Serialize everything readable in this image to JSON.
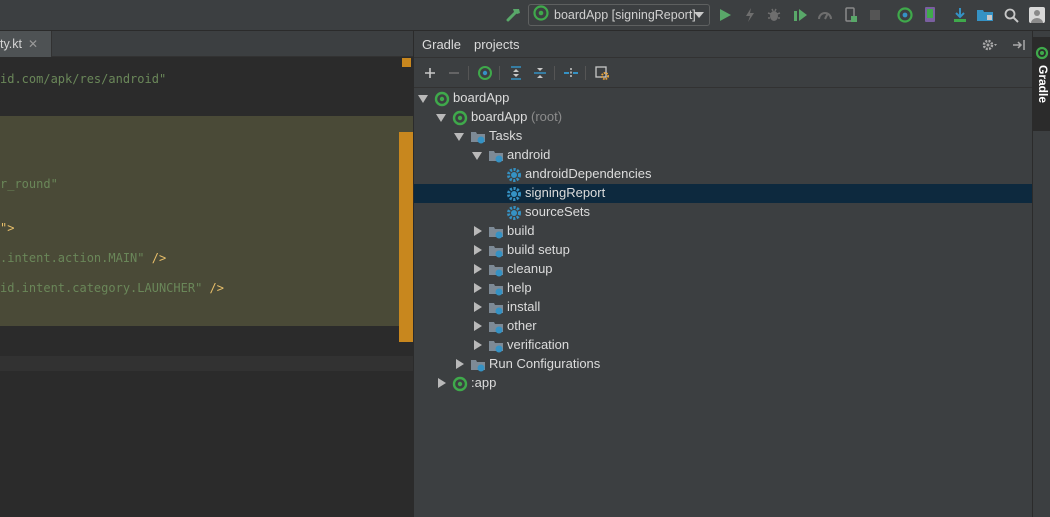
{
  "toolbar": {
    "run_config_label": "boardApp [signingReport]",
    "icons": [
      "build-hammer-icon",
      "run-config-gradle-icon",
      "run-icon",
      "apply-changes-icon",
      "debug-icon",
      "run-with-coverage-icon",
      "profile-icon",
      "attach-debugger-icon",
      "stop-icon",
      "sync-gradle-icon",
      "avd-manager-icon",
      "sdk-manager-icon",
      "project-structure-icon",
      "search-icon",
      "user-icon"
    ],
    "accent_run": "#59a869",
    "accent_gradle": "#3fa94b"
  },
  "editor": {
    "tab_name": "ty.kt",
    "tab_close": "✕",
    "lines": {
      "l1": "id.com/apk/res/android\"",
      "l2": "r_round\"",
      "l3": "\">",
      "l4a": ".intent.action.MAIN\"",
      "l4b": " />",
      "l5a": "id.intent.category.LAUNCHER\"",
      "l5b": " />"
    },
    "highlight_color": "#4a4a37",
    "marker_color": "#c8871e"
  },
  "gradle": {
    "tab_gradle": "Gradle",
    "tab_projects": "projects",
    "tree": {
      "root": "boardApp",
      "project": "boardApp",
      "project_suffix": "(root)",
      "tasks": "Tasks",
      "android": "android",
      "android_dependencies": "androidDependencies",
      "signing_report": "signingReport",
      "source_sets": "sourceSets",
      "build": "build",
      "build_setup": "build setup",
      "cleanup": "cleanup",
      "help": "help",
      "install": "install",
      "other": "other",
      "verification": "verification",
      "run_configurations": "Run Configurations",
      "app": ":app"
    },
    "selection_color": "#0d293e"
  },
  "right_strip": {
    "label": "Gradle"
  }
}
